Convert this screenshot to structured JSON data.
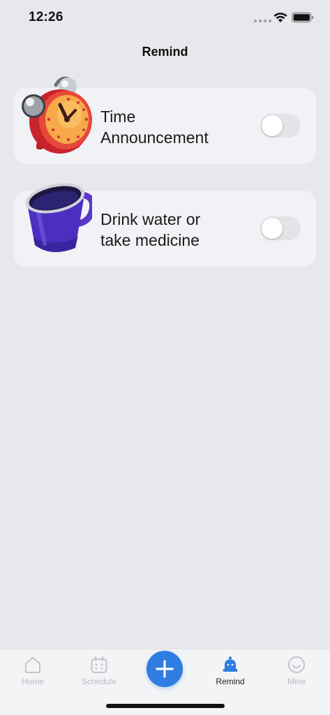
{
  "status_bar": {
    "time": "12:26",
    "icons": [
      "signal-dots-icon",
      "wifi-icon",
      "battery-icon"
    ]
  },
  "nav": {
    "title": "Remind"
  },
  "reminders": [
    {
      "label": "Time\nAnnouncement",
      "icon": "alarm-clock-icon",
      "enabled": false
    },
    {
      "label": "Drink water or\ntake medicine",
      "icon": "mug-icon",
      "enabled": false
    }
  ],
  "tab_bar": {
    "tabs": [
      {
        "label": "Home",
        "icon": "home-icon",
        "active": false
      },
      {
        "label": "Schedule",
        "icon": "calendar-icon",
        "active": false
      },
      {
        "label": "Remind",
        "icon": "bell-icon",
        "active": true
      },
      {
        "label": "Mine",
        "icon": "smiley-icon",
        "active": false
      }
    ],
    "add_button_icon": "plus-icon"
  },
  "colors": {
    "accent": "#2f7de1",
    "background": "#e7e8ec",
    "card": "#f1f2f5",
    "tab_inactive": "#b9bbc1"
  }
}
